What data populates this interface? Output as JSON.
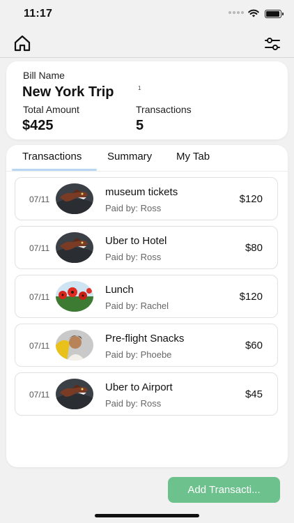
{
  "status_bar": {
    "time": "11:17"
  },
  "bill": {
    "name_label": "Bill Name",
    "name": "New York Trip",
    "superscript": "1",
    "total_label": "Total Amount",
    "total_value": "$425",
    "transactions_label": "Transactions",
    "transactions_value": "5"
  },
  "tabs": [
    {
      "label": "Transactions",
      "active": true
    },
    {
      "label": "Summary",
      "active": false
    },
    {
      "label": "My Tab",
      "active": false
    }
  ],
  "transactions": [
    {
      "date": "07/11",
      "title": "museum tickets",
      "payer": "Paid by: Ross",
      "amount": "$120",
      "avatar": "dinosaur"
    },
    {
      "date": "07/11",
      "title": "Uber to Hotel",
      "payer": "Paid by: Ross",
      "amount": "$80",
      "avatar": "dinosaur"
    },
    {
      "date": "07/11",
      "title": "Lunch",
      "payer": "Paid by: Rachel",
      "amount": "$120",
      "avatar": "poppies"
    },
    {
      "date": "07/11",
      "title": "Pre-flight Snacks",
      "payer": "Paid by: Phoebe",
      "amount": "$60",
      "avatar": "portrait"
    },
    {
      "date": "07/11",
      "title": "Uber to Airport",
      "payer": "Paid by: Ross",
      "amount": "$45",
      "avatar": "dinosaur"
    }
  ],
  "add_button": {
    "label": "Add Transacti..."
  },
  "colors": {
    "accent_green": "#6cc18d",
    "tab_underline": "#b9d7f2"
  }
}
